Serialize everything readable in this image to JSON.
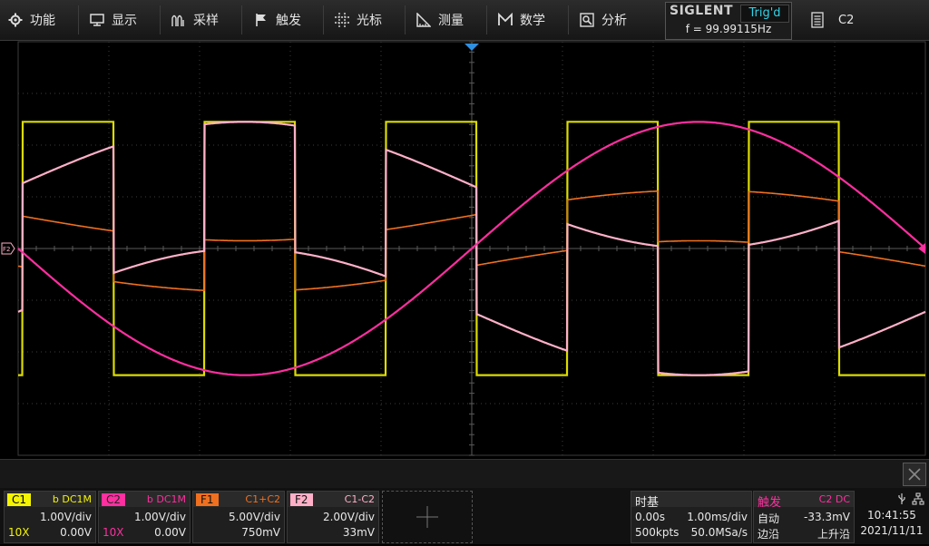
{
  "menu": {
    "items": [
      {
        "label": "功能",
        "icon": "gear-icon"
      },
      {
        "label": "显示",
        "icon": "monitor-icon"
      },
      {
        "label": "采样",
        "icon": "acquire-icon"
      },
      {
        "label": "触发",
        "icon": "flag-icon"
      },
      {
        "label": "光标",
        "icon": "cursor-cross-icon"
      },
      {
        "label": "测量",
        "icon": "ruler-icon"
      },
      {
        "label": "数学",
        "icon": "math-icon"
      },
      {
        "label": "分析",
        "icon": "analysis-icon"
      }
    ]
  },
  "status": {
    "brand": "SIGLENT",
    "trigger_state": "Trig'd",
    "frequency": "f = 99.99115Hz",
    "selected_channel": "C2"
  },
  "channels": [
    {
      "tag": "C1",
      "coupling": "b DC1M",
      "scale": "1.00V/div",
      "offset": "0.00V",
      "probe": "10X",
      "color": "#f4f400"
    },
    {
      "tag": "C2",
      "coupling": "b DC1M",
      "scale": "1.00V/div",
      "offset": "0.00V",
      "probe": "10X",
      "color": "#ff2fa0"
    },
    {
      "tag": "F1",
      "coupling": "C1+C2",
      "scale": "5.00V/div",
      "offset": "750mV",
      "probe": "",
      "color": "#f07020"
    },
    {
      "tag": "F2",
      "coupling": "C1-C2",
      "scale": "2.00V/div",
      "offset": "33mV",
      "probe": "",
      "color": "#ffb0c8"
    }
  ],
  "timebase": {
    "title": "时基",
    "delay": "0.00s",
    "scale": "1.00ms/div",
    "memory": "500kpts",
    "sample_rate": "50.0MSa/s"
  },
  "trigger": {
    "title": "触发",
    "source": "C2 DC",
    "mode": "自动",
    "level": "-33.3mV",
    "type": "边沿",
    "slope": "上升沿"
  },
  "clock": {
    "time": "10:41:55",
    "date": "2021/11/11"
  },
  "colors": {
    "c1": "#f4f400",
    "c2": "#ff2fa0",
    "f1": "#f07020",
    "f2": "#ffb0c8",
    "trigger_marker": "#2f8fe0",
    "grid": "#3c3c3c"
  },
  "markers": {
    "f2_label": "F2"
  }
}
